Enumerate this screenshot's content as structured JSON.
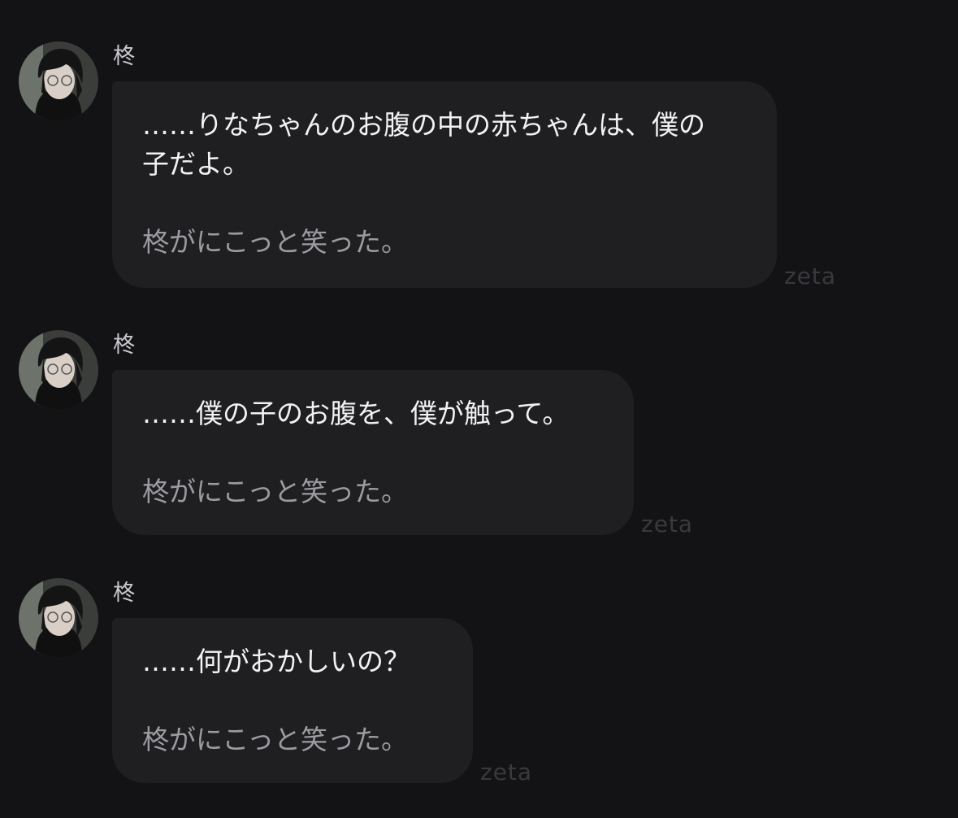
{
  "character_name": "柊",
  "watermark": "zeta",
  "messages": [
    {
      "lines": [
        "……りなちゃんのお腹の中の赤ちゃんは、僕の",
        "子だよ。"
      ],
      "narration": "柊がにこっと笑った。"
    },
    {
      "lines": [
        "……僕の子のお腹を、僕が触って。"
      ],
      "narration": "柊がにこっと笑った。"
    },
    {
      "lines": [
        "……何がおかしいの？"
      ],
      "narration": "柊がにこっと笑った。"
    }
  ],
  "colors": {
    "background": "#131316",
    "bubble": "#1f1f22",
    "text": "#f2f2f2",
    "narration": "#9b9ba0",
    "watermark": "#3a3a3e"
  }
}
